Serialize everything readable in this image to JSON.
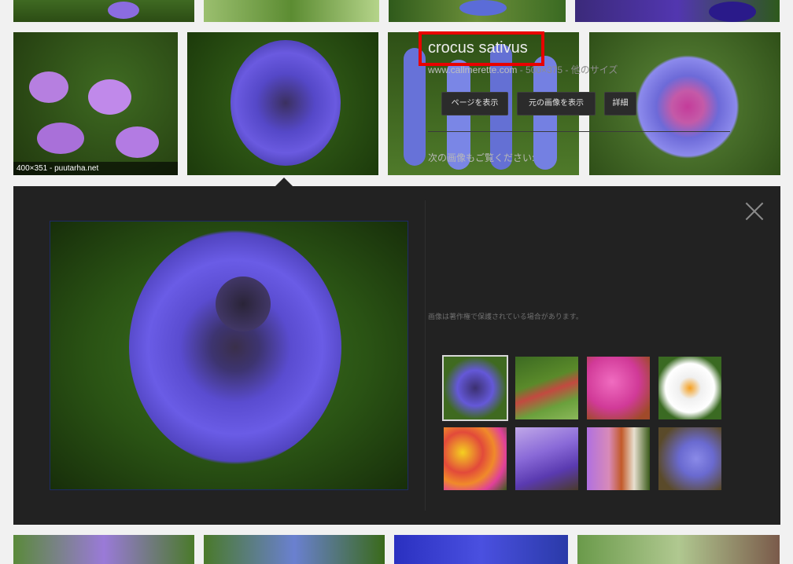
{
  "grid": {
    "row2_caption": "400×351 - puutarha.net"
  },
  "panel": {
    "title": "crocus sativus",
    "site": "www.callmerette.com",
    "size_info": " - 500×375 - 他のサイズ",
    "buttons": [
      "ページを表示",
      "元の画像を表示",
      "詳細"
    ],
    "related_label": "次の画像もご覧ください:",
    "copyright": "画像は著作権で保護されている場合があります。",
    "close_icon": "close-icon"
  },
  "colors": {
    "panel_bg": "#222222",
    "highlight_border": "#e80000",
    "page_bg": "#f1f1f1"
  }
}
